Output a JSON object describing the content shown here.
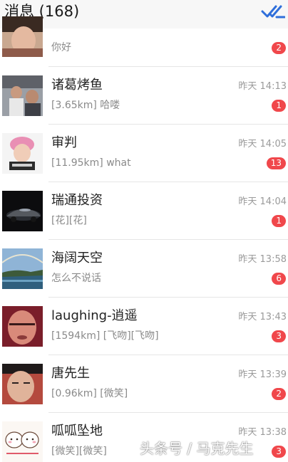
{
  "header": {
    "title": "消息 (168)",
    "mark_read_icon": "double-check-icon",
    "accent": "#2f6fdb"
  },
  "messages": [
    {
      "name": "",
      "preview": "你好",
      "time": "",
      "badge": "2"
    },
    {
      "name": "诸葛烤鱼",
      "preview": "[3.65km] 哈喽",
      "time": "昨天 14:13",
      "badge": "1"
    },
    {
      "name": "审判",
      "preview": "[11.95km] what",
      "time": "昨天 14:05",
      "badge": "13"
    },
    {
      "name": "瑞通投资",
      "preview": "[花][花]",
      "time": "昨天 14:04",
      "badge": "1"
    },
    {
      "name": "海阔天空",
      "preview": "怎么不说话",
      "time": "昨天 13:58",
      "badge": "6"
    },
    {
      "name": "laughing-逍遥",
      "preview": "[1594km] [飞吻][飞吻]",
      "time": "昨天 13:43",
      "badge": "3"
    },
    {
      "name": "唐先生",
      "preview": "[0.96km] [微笑]",
      "time": "昨天 13:39",
      "badge": "2"
    },
    {
      "name": "呱呱坠地",
      "preview": "[微笑][微笑]",
      "time": "昨天 13:38",
      "badge": "3"
    }
  ],
  "watermark": "头条号 / 马克先生",
  "colors": {
    "badge": "#f0474b",
    "header_bg": "#f7f7f7",
    "divider": "#e6e6e6"
  }
}
